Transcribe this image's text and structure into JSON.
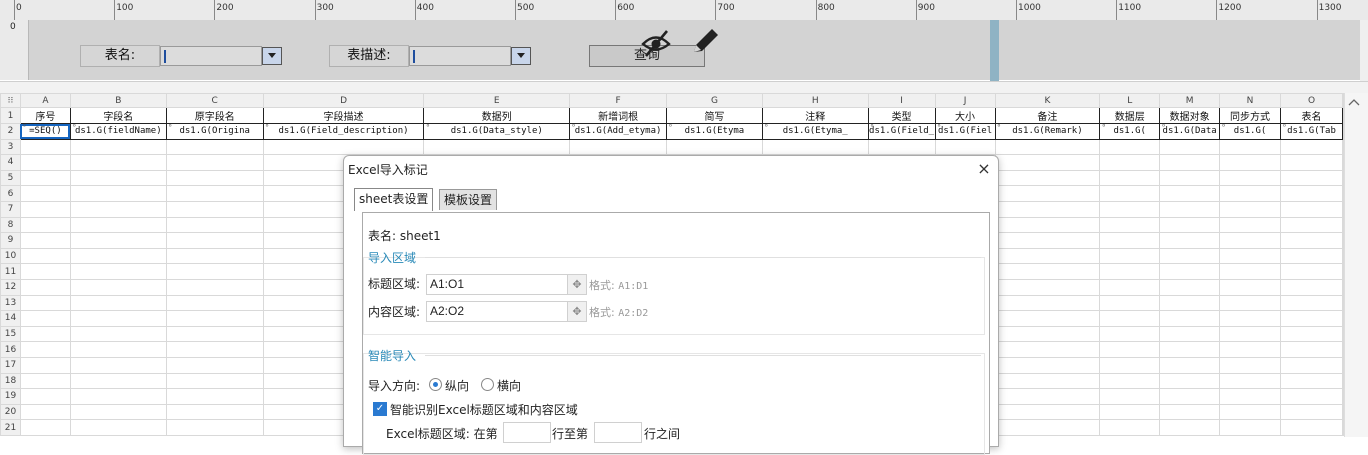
{
  "ruler": {
    "labels": [
      "0",
      "100",
      "200",
      "300",
      "400",
      "500",
      "600",
      "700",
      "800",
      "900",
      "1000",
      "1100",
      "1200",
      "1300"
    ],
    "vertical_label": "0"
  },
  "params": {
    "table_name_label": "表名:",
    "table_desc_label": "表描述:",
    "query_label": "查询",
    "icons": [
      "eye-hidden-icon",
      "pencil-icon",
      "dropdown-icon"
    ]
  },
  "grid": {
    "col_letters": [
      "A",
      "B",
      "C",
      "D",
      "E",
      "F",
      "G",
      "H",
      "I",
      "J",
      "K",
      "L",
      "M",
      "N",
      "O"
    ],
    "row_numbers": [
      "1",
      "2",
      "3",
      "4",
      "5",
      "6",
      "7",
      "8",
      "9",
      "10",
      "11",
      "12",
      "13",
      "14",
      "15",
      "16",
      "17",
      "18",
      "19",
      "20",
      "21"
    ],
    "headers": [
      "序号",
      "字段名",
      "原字段名",
      "字段描述",
      "数据列",
      "新增词根",
      "简写",
      "注释",
      "类型",
      "大小",
      "备注",
      "数据层",
      "数据对象",
      "同步方式",
      "表名"
    ],
    "row2": [
      "=SEQ()",
      "ds1.G(fieldName)",
      "ds1.G(Origina",
      "ds1.G(Field_description)",
      "ds1.G(Data_style)",
      "ds1.G(Add_etyma)",
      "ds1.G(Etyma",
      "ds1.G(Etyma_",
      "ds1.G(Field_",
      "ds1.G(Fiel",
      "ds1.G(Remark)",
      "ds1.G(",
      "ds1.G(Data",
      "ds1.G(",
      "ds1.G(Tab"
    ]
  },
  "dialog": {
    "title": "Excel导入标记",
    "close": "×",
    "tabs": [
      "sheet表设置",
      "模板设置"
    ],
    "sheet_name": "表名: sheet1",
    "import_area_title": "导入区域",
    "title_area_label": "标题区域:",
    "title_area_value": "A1:O1",
    "content_area_label": "内容区域:",
    "content_area_value": "A2:O2",
    "format_label": "格式:",
    "title_format_example": "A1:D1",
    "content_format_example": "A2:D2",
    "smart_import_title": "智能导入",
    "direction_label": "导入方向:",
    "direction_vertical": "纵向",
    "direction_horizontal": "横向",
    "direction_selected": "纵向",
    "smart_recognize_label": "智能识别Excel标题区域和内容区域",
    "smart_recognize_checked": true,
    "excel_title_area_label": "Excel标题区域: 在第",
    "row_to_label": "行至第",
    "between_label": "行之间"
  },
  "colors": {
    "accent": "#2a7ad1",
    "section_title": "#2a8ab8",
    "splitter": "#8fb3c4"
  }
}
